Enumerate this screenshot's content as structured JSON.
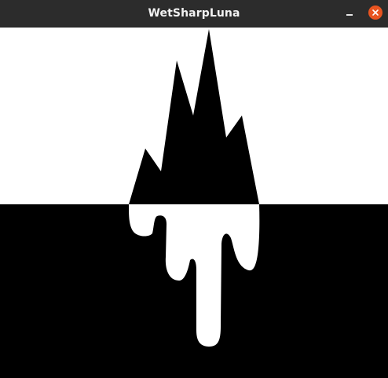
{
  "window": {
    "title": "WetSharpLuna",
    "controls": {
      "minimize": "minimize-icon",
      "close": "close-icon"
    }
  },
  "canvas": {
    "colors": {
      "sky": "#ffffff",
      "ground": "#000000",
      "castle": "#000000",
      "reflection": "#ffffff"
    }
  }
}
